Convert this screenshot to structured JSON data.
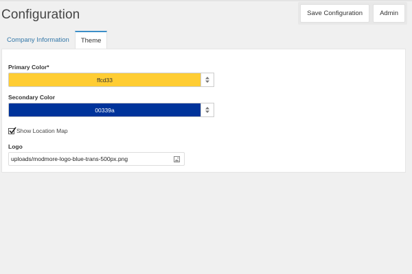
{
  "page": {
    "title": "Configuration"
  },
  "header": {
    "save_label": "Save Configuration",
    "admin_label": "Admin"
  },
  "tabs": [
    {
      "label": "Company Information",
      "active": false
    },
    {
      "label": "Theme",
      "active": true
    }
  ],
  "theme": {
    "primary": {
      "label": "Primary Color*",
      "value": "ffcd33",
      "color": "#ffcd33",
      "text_color": "#333333"
    },
    "secondary": {
      "label": "Secondary Color",
      "value": "00339a",
      "color": "#00339a",
      "text_color": "#ffffff"
    },
    "show_location_map": {
      "label": "Show Location Map",
      "checked": true
    },
    "logo": {
      "label": "Logo",
      "value": "uploads/modmore-logo-blue-trans-500px.png"
    }
  },
  "icons": {
    "spin": "up-down-arrows-icon",
    "check": "checkmark-icon",
    "file": "image-file-icon"
  }
}
